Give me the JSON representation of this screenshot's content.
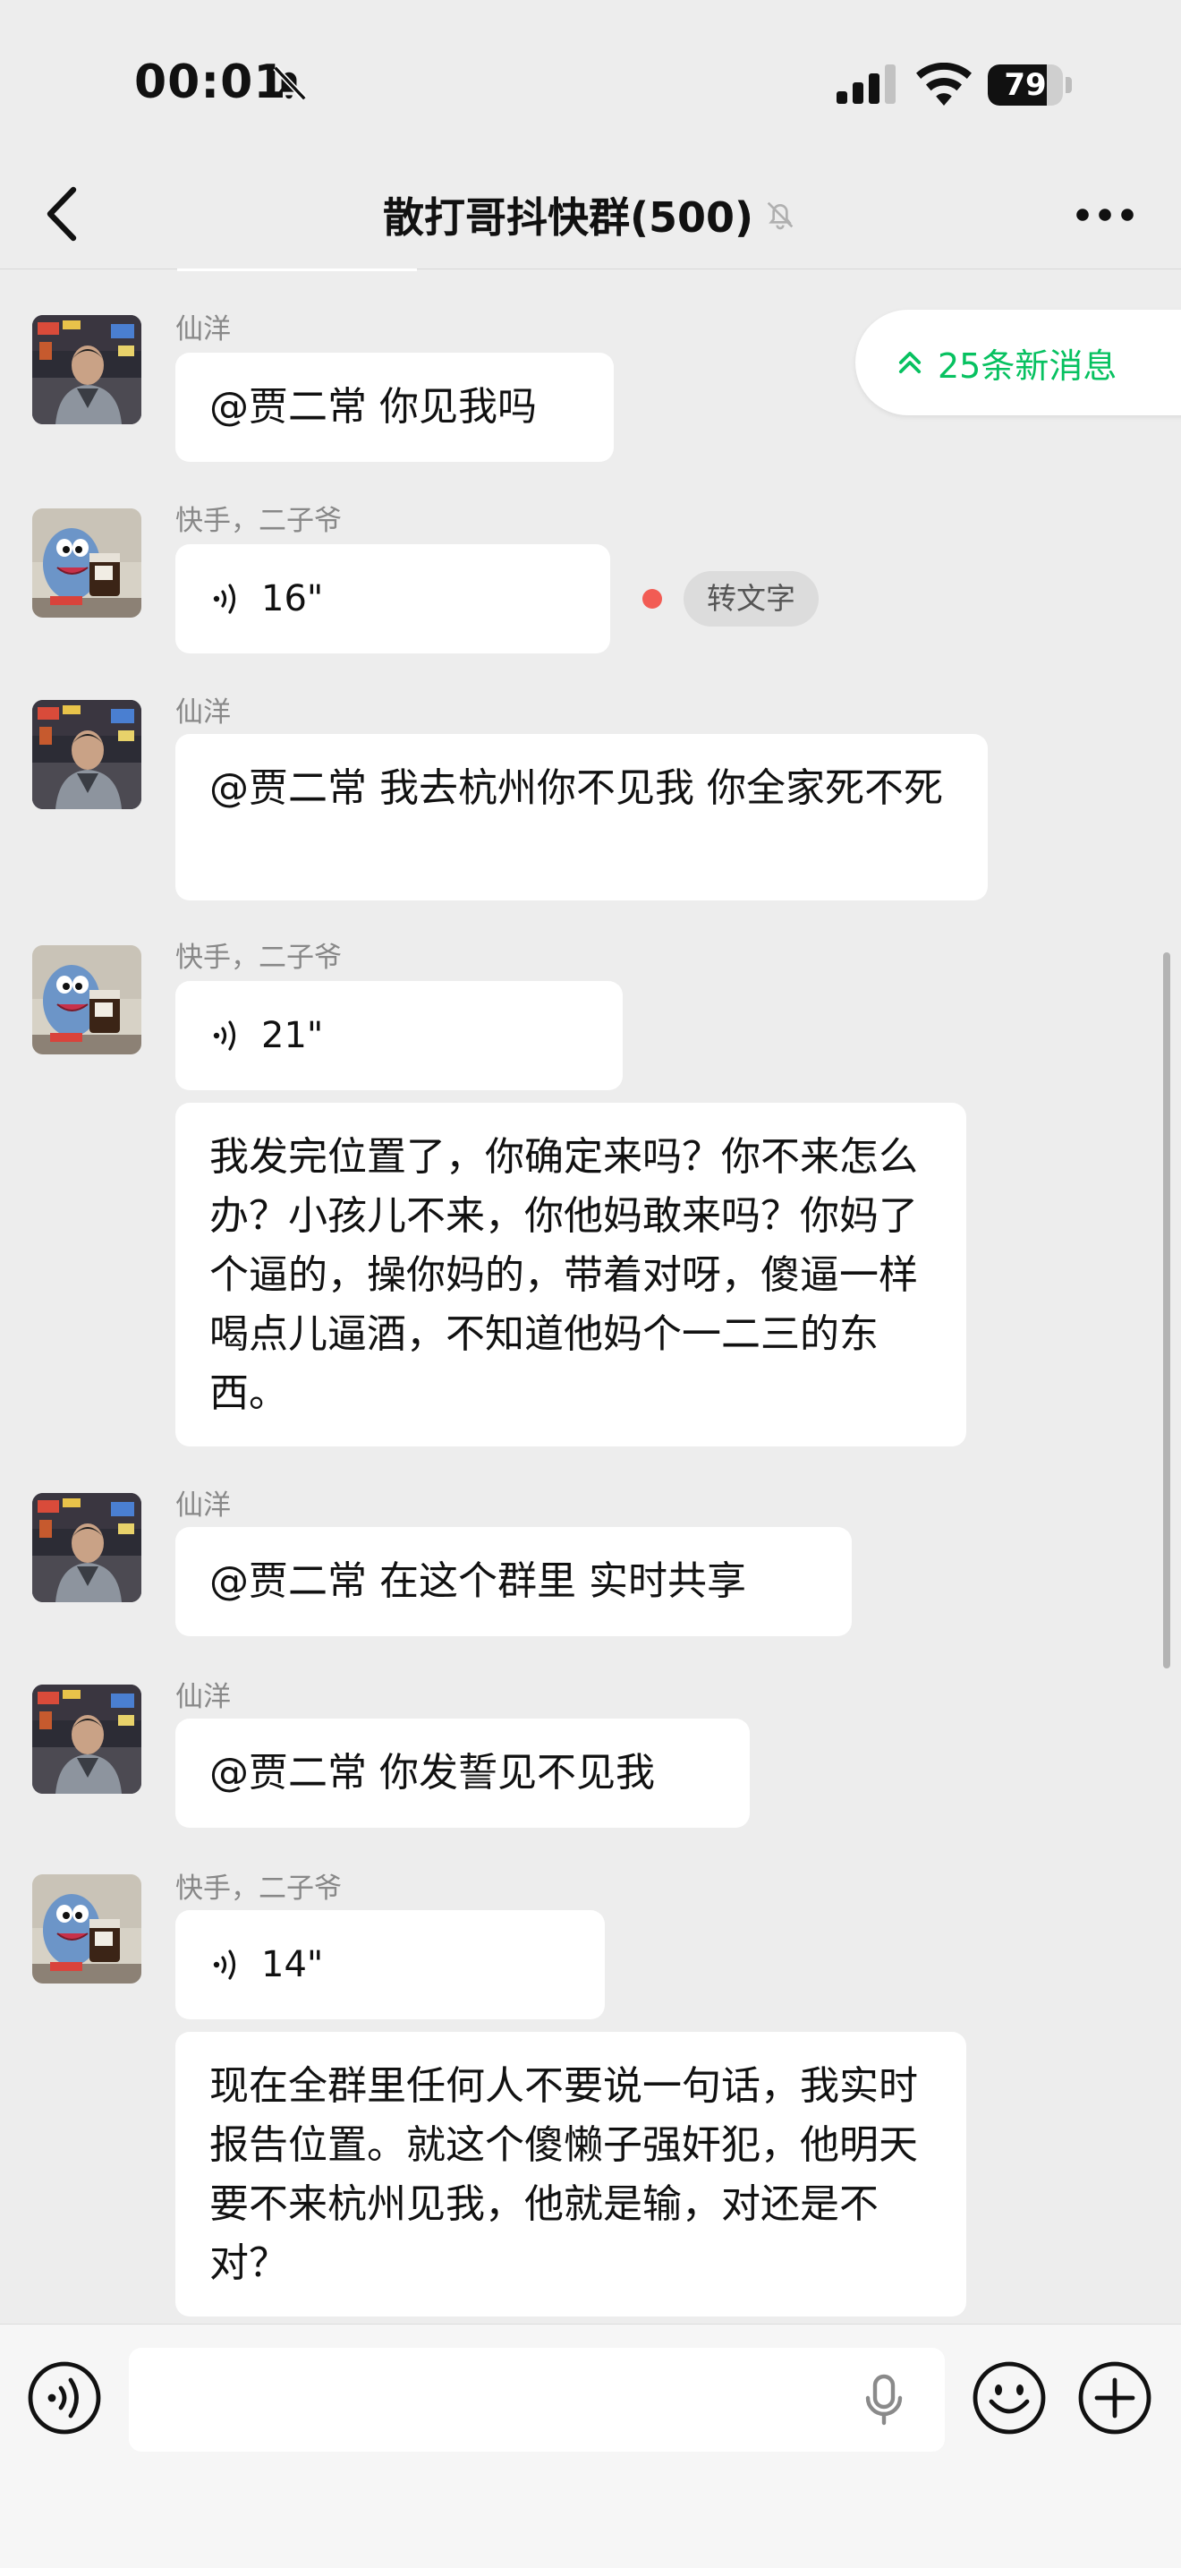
{
  "status_bar": {
    "time": "00:01",
    "battery_level": "79",
    "battery_fraction": 0.79
  },
  "nav": {
    "title": "散打哥抖快群(500)",
    "back_icon": "chevron-left-icon",
    "more_icon": "more-dots-icon",
    "muted_icon": "bell-off-icon"
  },
  "new_messages": {
    "label": "25条新消息",
    "icon": "double-chevron-up-icon"
  },
  "messages": [
    {
      "sender": "仙洋",
      "type": "text",
      "text": "@贾二常 你见我吗"
    },
    {
      "sender": "快手，二子爷",
      "type": "voice",
      "duration": "16\"",
      "unread": true,
      "convert_label": "转文字"
    },
    {
      "sender": "仙洋",
      "type": "text",
      "text": "@贾二常 我去杭州你不见我 你全家死不死"
    },
    {
      "sender": "快手，二子爷",
      "type": "voice",
      "duration": "21\""
    },
    {
      "sender": "",
      "type": "text",
      "text": "我发完位置了，你确定来吗？你不来怎么办？小孩儿不来，你他妈敢来吗？你妈了个逼的，操你妈的，带着对呀，傻逼一样喝点儿逼酒，不知道他妈个一二三的东西。"
    },
    {
      "sender": "仙洋",
      "type": "text",
      "text": "@贾二常 在这个群里 实时共享"
    },
    {
      "sender": "仙洋",
      "type": "text",
      "text": "@贾二常 你发誓见不见我"
    },
    {
      "sender": "快手，二子爷",
      "type": "voice",
      "duration": "14\""
    },
    {
      "sender": "",
      "type": "text",
      "text": "现在全群里任何人不要说一句话，我实时报告位置。就这个傻懒子强奸犯，他明天要不来杭州见我，他就是输，对还是不对？"
    }
  ],
  "input_bar": {
    "placeholder": "",
    "voice_icon": "voice-mode-icon",
    "mic_icon": "microphone-icon",
    "emoji_icon": "emoji-icon",
    "plus_icon": "plus-icon"
  },
  "colors": {
    "background": "#ededed",
    "bubble": "#ffffff",
    "accent_green": "#07c160",
    "unread_dot": "#f25c54"
  }
}
